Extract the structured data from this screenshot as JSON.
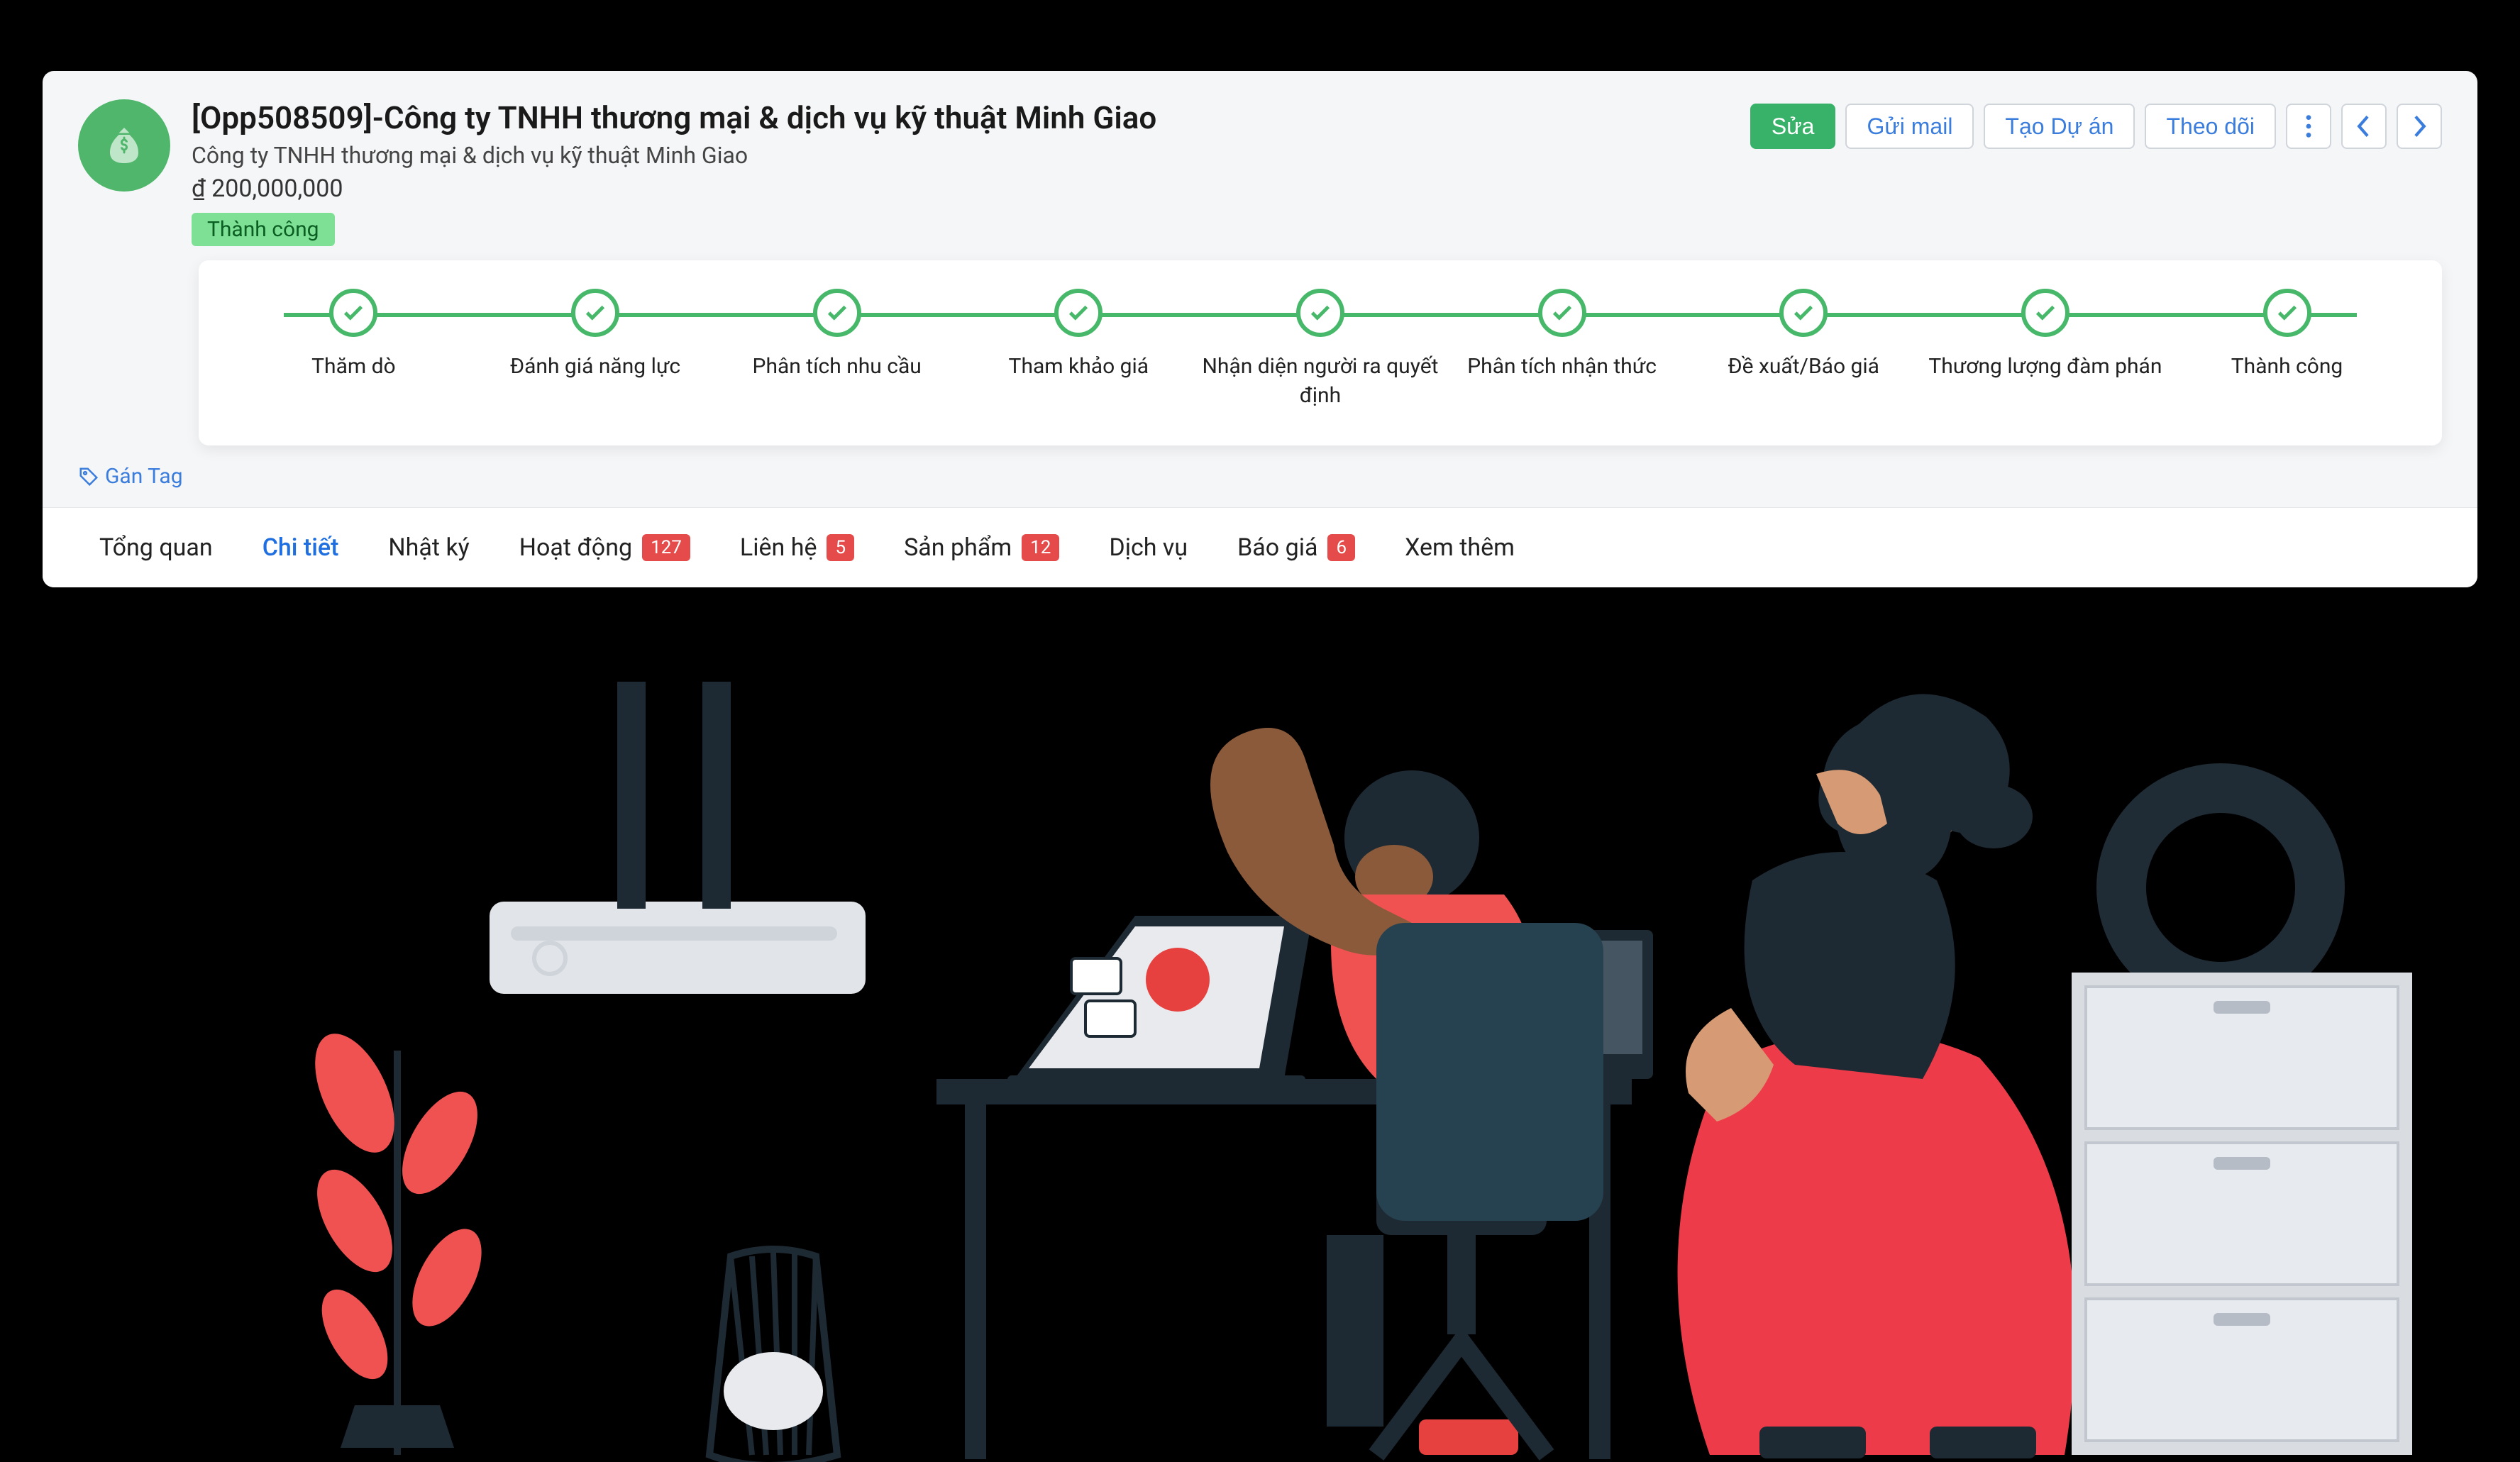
{
  "header": {
    "title": "[Opp508509]-Công ty TNHH thương mại & dịch vụ kỹ thuật Minh Giao",
    "subtitle": "Công ty TNHH thương mại & dịch vụ kỹ thuật Minh Giao",
    "amount": "₫ 200,000,000",
    "status": "Thành công"
  },
  "actions": {
    "edit": "Sửa",
    "send_mail": "Gửi mail",
    "create_project": "Tạo Dự án",
    "follow": "Theo dõi"
  },
  "steps": [
    {
      "label": "Thăm dò"
    },
    {
      "label": "Đánh giá năng lực"
    },
    {
      "label": "Phân tích nhu cầu"
    },
    {
      "label": "Tham khảo giá"
    },
    {
      "label": "Nhận diện người ra quyết định"
    },
    {
      "label": "Phân tích nhận thức"
    },
    {
      "label": "Đề xuất/Báo giá"
    },
    {
      "label": "Thương lượng đàm phán"
    },
    {
      "label": "Thành công"
    }
  ],
  "tag_action": "Gán Tag",
  "tabs": {
    "overview": "Tổng quan",
    "details": "Chi tiết",
    "journal": "Nhật ký",
    "activity": "Hoạt động",
    "activity_count": "127",
    "contacts": "Liên hệ",
    "contacts_count": "5",
    "products": "Sản phẩm",
    "products_count": "12",
    "services": "Dịch vụ",
    "quotes": "Báo giá",
    "quotes_count": "6",
    "more": "Xem thêm"
  },
  "colors": {
    "primary_green": "#38b269",
    "progress_green": "#47b86a",
    "link_blue": "#3b7ddd",
    "badge_red": "#e64b4b"
  }
}
